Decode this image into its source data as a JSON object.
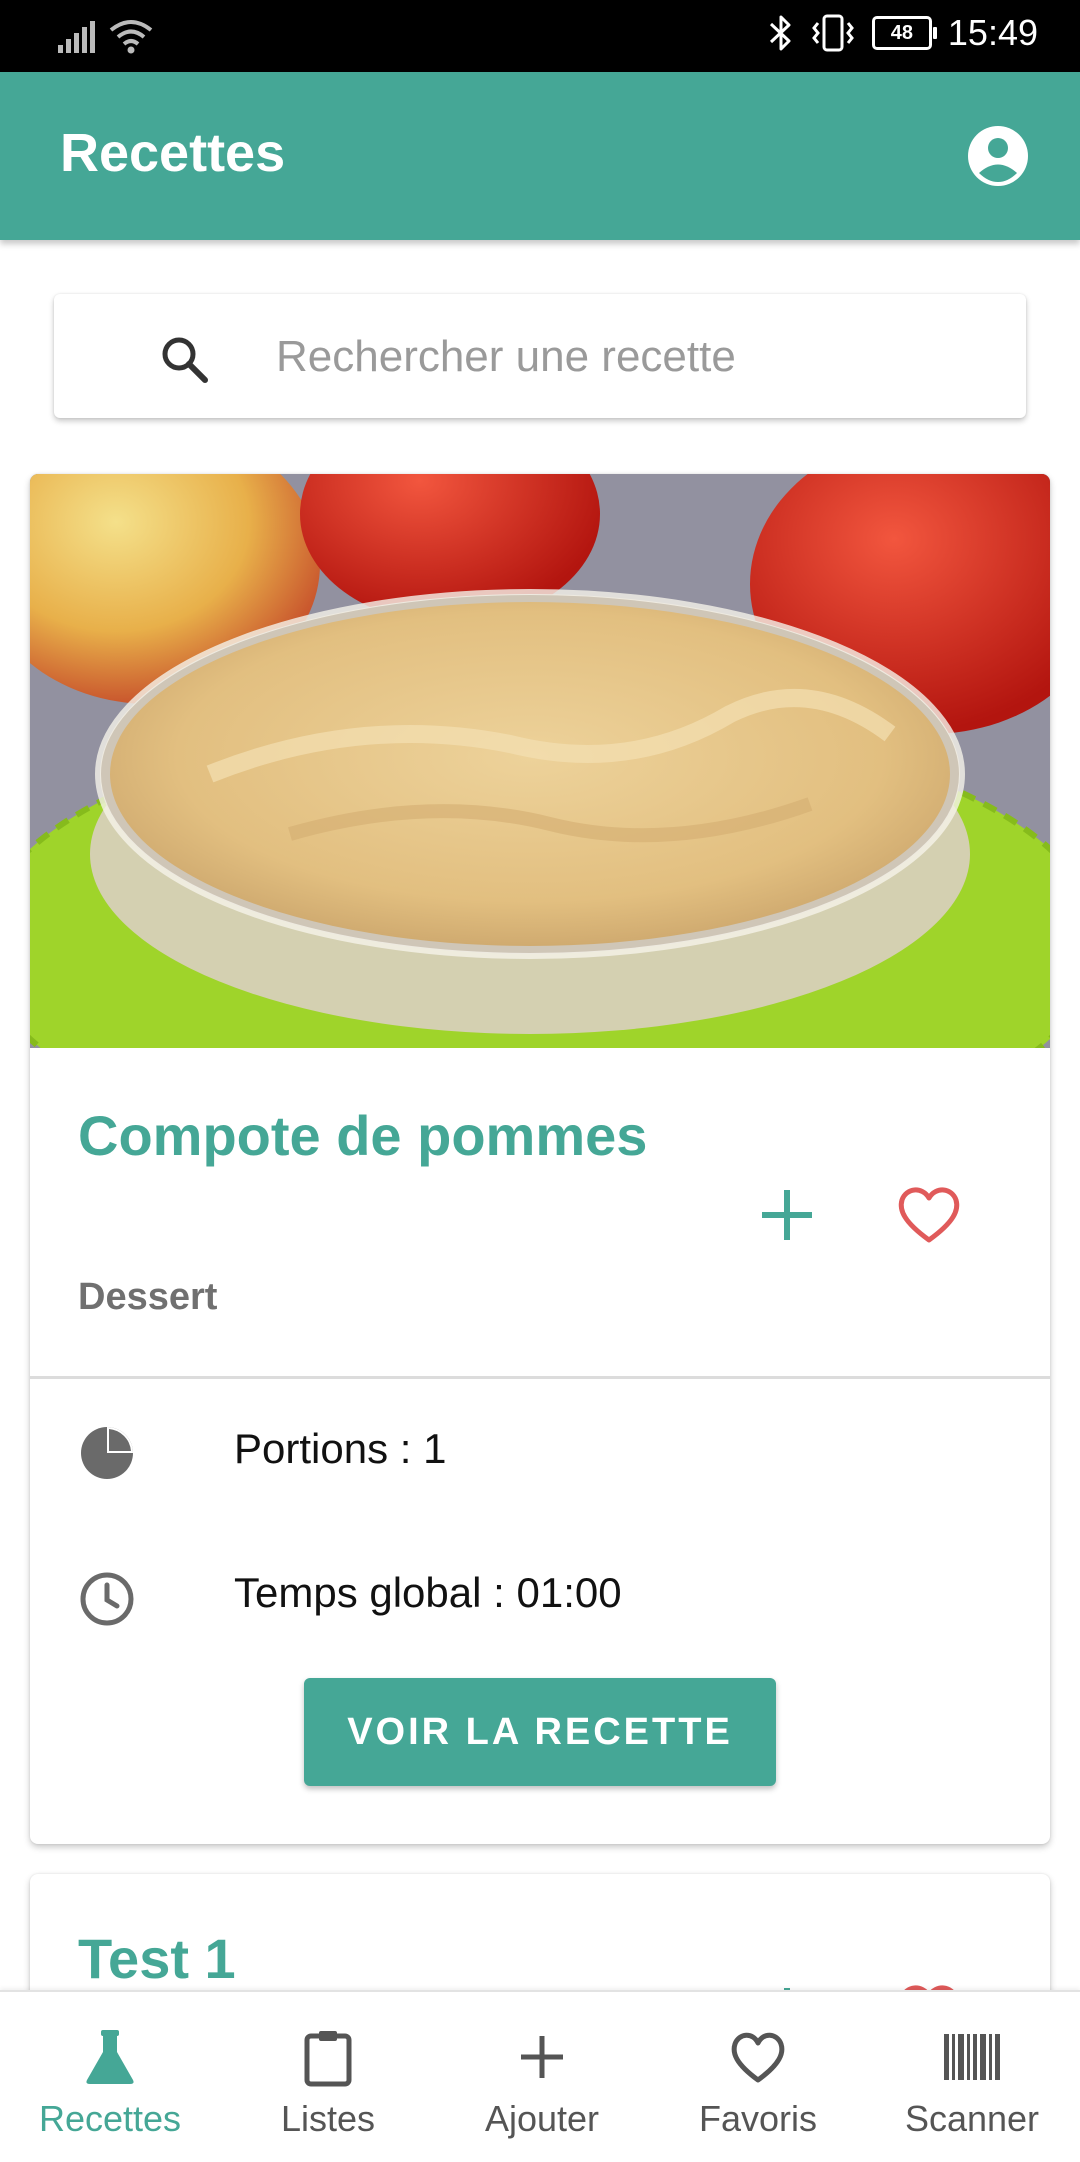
{
  "status_bar": {
    "time": "15:49",
    "battery": "48",
    "icons": [
      "signal-icon",
      "wifi-icon",
      "bluetooth-icon",
      "vibrate-icon",
      "battery-icon"
    ]
  },
  "app_bar": {
    "title": "Recettes",
    "account_icon": "account-circle-icon"
  },
  "search": {
    "placeholder": "Rechercher une recette",
    "value": ""
  },
  "recipes": [
    {
      "title": "Compote de pommes",
      "category": "Dessert",
      "portions": "Portions : 1",
      "time": "Temps global : 01:00",
      "button": "VOIR LA RECETTE",
      "favorite": false
    },
    {
      "title": "Test 1"
    }
  ],
  "bottom_nav": [
    {
      "label": "Recettes",
      "icon": "flask-icon",
      "active": true
    },
    {
      "label": "Listes",
      "icon": "clipboard-icon",
      "active": false
    },
    {
      "label": "Ajouter",
      "icon": "plus-icon",
      "active": false
    },
    {
      "label": "Favoris",
      "icon": "heart-icon",
      "active": false
    },
    {
      "label": "Scanner",
      "icon": "barcode-icon",
      "active": false
    }
  ],
  "colors": {
    "primary": "#45a796",
    "favorite": "#e05a5a",
    "status_bar": "#000000"
  }
}
